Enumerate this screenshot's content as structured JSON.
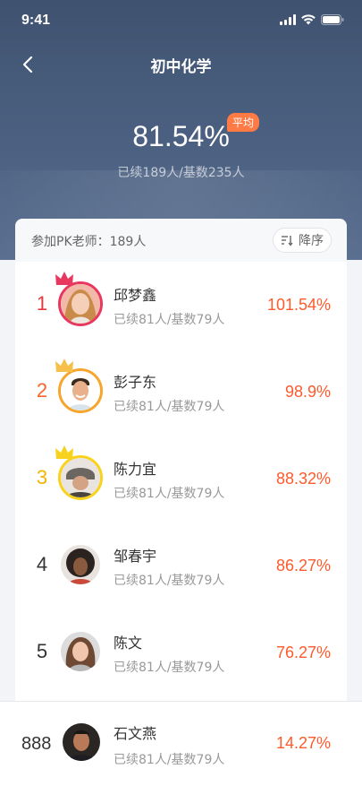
{
  "status_bar": {
    "time": "9:41"
  },
  "nav": {
    "title": "初中化学",
    "back_icon": "chevron-left-icon"
  },
  "summary": {
    "average_value": "81.54%",
    "average_badge": "平均",
    "detail": "已续189人/基数235人"
  },
  "list_header": {
    "pk_label": "参加PK老师：189人",
    "sort_label": "降序",
    "sort_icon": "sort-desc-icon"
  },
  "colors": {
    "header_bg": "#4a5d7c",
    "accent": "#ff5a2c",
    "rank_1": "#e8383d",
    "rank_2": "#f7652b",
    "rank_3": "#f5b400",
    "rank_default": "#333333"
  },
  "teachers": [
    {
      "rank": "1",
      "name": "邱梦鑫",
      "detail": "已续81人/基数79人",
      "percent": "101.54%"
    },
    {
      "rank": "2",
      "name": "彭子东",
      "detail": "已续81人/基数79人",
      "percent": "98.9%"
    },
    {
      "rank": "3",
      "name": "陈力宜",
      "detail": "已续81人/基数79人",
      "percent": "88.32%"
    },
    {
      "rank": "4",
      "name": "邹春宇",
      "detail": "已续81人/基数79人",
      "percent": "86.27%"
    },
    {
      "rank": "5",
      "name": "陈文",
      "detail": "已续81人/基数79人",
      "percent": "76.27%"
    }
  ],
  "me": {
    "rank": "888",
    "name": "石文燕",
    "detail": "已续81人/基数79人",
    "percent": "14.27%"
  }
}
